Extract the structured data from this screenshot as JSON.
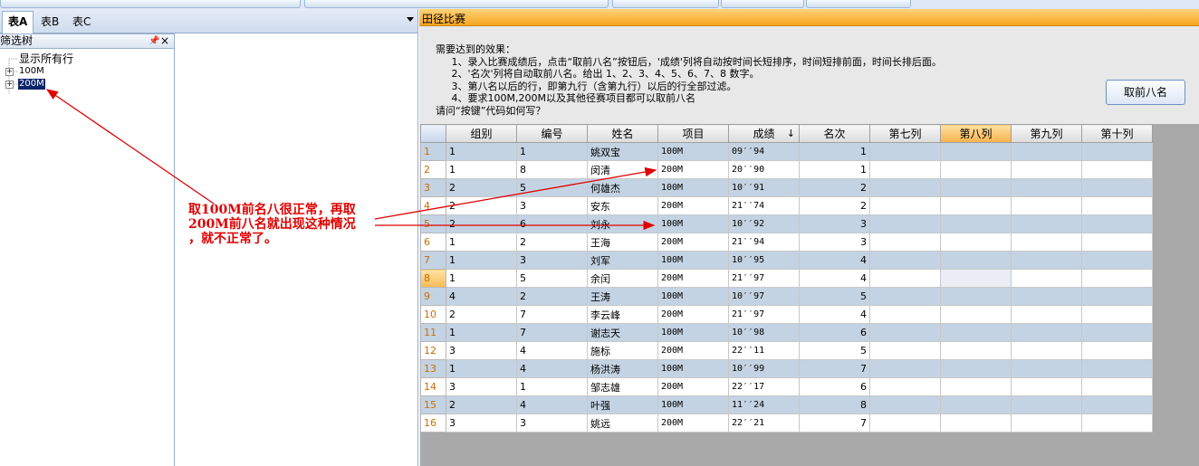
{
  "left": {
    "tabs": [
      "表A",
      "表B",
      "表C"
    ],
    "filter_panel": {
      "title": "筛选树",
      "pin_icon": "📌",
      "close_icon": "×",
      "tree": {
        "root": "显示所有行",
        "items": [
          "100M",
          "200M"
        ]
      }
    }
  },
  "annotation": {
    "lines": [
      "取100M前名八很正常，再取",
      "200M前八名就出现这种情况",
      "，就不正常了。"
    ],
    "color": "#e00000"
  },
  "right": {
    "title": "田径比赛",
    "description": "需要达到的效果：\n     1、录入比赛成绩后，点击“取前八名”按钮后，'成绩'列将自动按时间长短排序，时间短排前面，时间长排后面。\n     2、'名次'列将自动取前八名。给出 1、2、3、4、5、6、7、8 数字。\n     3、第八名以后的行，即第九行（含第九行）以后的行全部过滤。\n     4、要求100M,200M以及其他径赛项目都可以取前八名\n请问“按键”代码如何写？",
    "button": "取前八名",
    "grid": {
      "columns": [
        "组别",
        "编号",
        "姓名",
        "项目",
        "成绩",
        "名次",
        "第七列",
        "第八列",
        "第九列",
        "第十列"
      ],
      "sort_indicator": "↓",
      "rows": [
        [
          "1",
          "1",
          "1",
          "姚双宝",
          "100M",
          "09′′94",
          "1"
        ],
        [
          "2",
          "1",
          "8",
          "闵清",
          "200M",
          "20′′90",
          "1"
        ],
        [
          "3",
          "2",
          "5",
          "何雄杰",
          "100M",
          "10′′91",
          "2"
        ],
        [
          "4",
          "2",
          "3",
          "安东",
          "200M",
          "21′′74",
          "2"
        ],
        [
          "5",
          "2",
          "6",
          "刘永",
          "100M",
          "10′′92",
          "3"
        ],
        [
          "6",
          "1",
          "2",
          "王海",
          "200M",
          "21′′94",
          "3"
        ],
        [
          "7",
          "1",
          "3",
          "刘军",
          "100M",
          "10′′95",
          "4"
        ],
        [
          "8",
          "1",
          "5",
          "余闰",
          "200M",
          "21′′97",
          "4"
        ],
        [
          "9",
          "4",
          "2",
          "王涛",
          "100M",
          "10′′97",
          "5"
        ],
        [
          "10",
          "2",
          "7",
          "李云峰",
          "200M",
          "21′′97",
          "4"
        ],
        [
          "11",
          "1",
          "7",
          "谢志天",
          "100M",
          "10′′98",
          "6"
        ],
        [
          "12",
          "3",
          "4",
          "施标",
          "200M",
          "22′′11",
          "5"
        ],
        [
          "13",
          "1",
          "4",
          "杨洪涛",
          "100M",
          "10′′99",
          "7"
        ],
        [
          "14",
          "3",
          "1",
          "邹志雄",
          "200M",
          "22′′17",
          "6"
        ],
        [
          "15",
          "2",
          "4",
          "叶强",
          "100M",
          "11′′24",
          "8"
        ],
        [
          "16",
          "3",
          "3",
          "姚远",
          "200M",
          "22′′21",
          "7"
        ]
      ]
    }
  }
}
